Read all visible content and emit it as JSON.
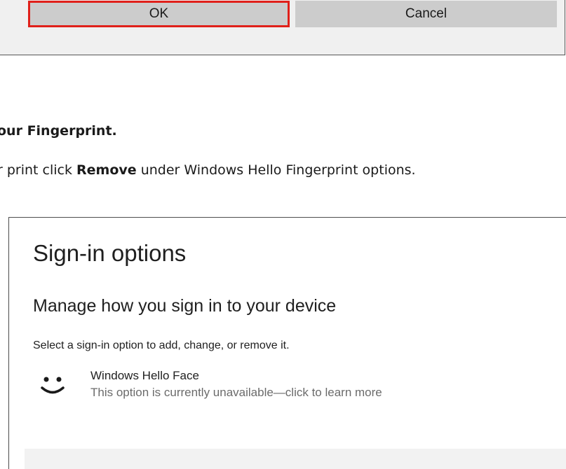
{
  "dialog": {
    "ok_label": "OK",
    "cancel_label": "Cancel"
  },
  "doc": {
    "heading": "our Fingerprint.",
    "instruction_prefix": "r print click ",
    "instruction_bold": "Remove",
    "instruction_suffix": " under Windows Hello Fingerprint options."
  },
  "signin": {
    "title": "Sign-in options",
    "subtitle": "Manage how you sign in to your device",
    "description": "Select a sign-in option to add, change, or remove it.",
    "options": [
      {
        "icon": "face-icon",
        "name": "Windows Hello Face",
        "note": "This option is currently unavailable—click to learn more"
      }
    ]
  },
  "colors": {
    "focus_border": "#e0201a",
    "button_bg": "#cccccc",
    "dialog_bg": "#f0f0f0",
    "muted_text": "#6b6b6b"
  }
}
